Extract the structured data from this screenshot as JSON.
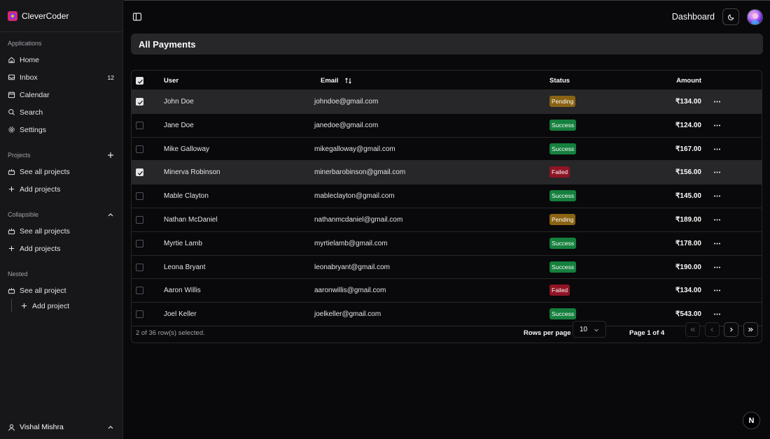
{
  "app": {
    "name": "CleverCoder"
  },
  "sidebar": {
    "applications_label": "Applications",
    "applications": [
      {
        "label": "Home",
        "icon": "home-icon"
      },
      {
        "label": "Inbox",
        "icon": "inbox-icon",
        "badge": "12"
      },
      {
        "label": "Calendar",
        "icon": "calendar-icon"
      },
      {
        "label": "Search",
        "icon": "search-icon"
      },
      {
        "label": "Settings",
        "icon": "settings-icon"
      }
    ],
    "projects_label": "Projects",
    "projects": [
      {
        "label": "See all projects",
        "icon": "projects-icon"
      },
      {
        "label": "Add projects",
        "icon": "plus-icon"
      }
    ],
    "collapsible_label": "Collapsible",
    "collapsible": [
      {
        "label": "See all projects",
        "icon": "projects-icon"
      },
      {
        "label": "Add projects",
        "icon": "plus-icon"
      }
    ],
    "nested_label": "Nested",
    "nested": [
      {
        "label": "See all project",
        "icon": "projects-icon"
      },
      {
        "label": "Add project",
        "icon": "plus-icon"
      }
    ],
    "user_name": "Vishal Mishra"
  },
  "header": {
    "title": "Dashboard"
  },
  "page": {
    "title": "All Payments"
  },
  "table": {
    "columns": {
      "user": "User",
      "email": "Email",
      "status": "Status",
      "amount": "Amount"
    },
    "rows": [
      {
        "user": "John Doe",
        "email": "johndoe@gmail.com",
        "status": "Pending",
        "amount": "₹134.00",
        "selected": true
      },
      {
        "user": "Jane Doe",
        "email": "janedoe@gmail.com",
        "status": "Success",
        "amount": "₹124.00",
        "selected": false
      },
      {
        "user": "Mike Galloway",
        "email": "mikegalloway@gmail.com",
        "status": "Success",
        "amount": "₹167.00",
        "selected": false
      },
      {
        "user": "Minerva Robinson",
        "email": "minerbarobinson@gmail.com",
        "status": "Failed",
        "amount": "₹156.00",
        "selected": true
      },
      {
        "user": "Mable Clayton",
        "email": "mableclayton@gmail.com",
        "status": "Success",
        "amount": "₹145.00",
        "selected": false
      },
      {
        "user": "Nathan McDaniel",
        "email": "nathanmcdaniel@gmail.com",
        "status": "Pending",
        "amount": "₹189.00",
        "selected": false
      },
      {
        "user": "Myrtie Lamb",
        "email": "myrtielamb@gmail.com",
        "status": "Success",
        "amount": "₹178.00",
        "selected": false
      },
      {
        "user": "Leona Bryant",
        "email": "leonabryant@gmail.com",
        "status": "Success",
        "amount": "₹190.00",
        "selected": false
      },
      {
        "user": "Aaron Willis",
        "email": "aaronwillis@gmail.com",
        "status": "Failed",
        "amount": "₹134.00",
        "selected": false
      },
      {
        "user": "Joel Keller",
        "email": "joelkeller@gmail.com",
        "status": "Success",
        "amount": "₹543.00",
        "selected": false
      }
    ],
    "selection_text": "2 of 36 row(s) selected.",
    "rows_per_page_label": "Rows per page",
    "rows_per_page_value": "10",
    "page_info": "Page 1 of 4"
  },
  "colors": {
    "pending": "#8a6414",
    "success": "#15803d",
    "failed": "#8f1424",
    "background": "#09090b",
    "sidebar": "#171719"
  },
  "next_badge": "N"
}
